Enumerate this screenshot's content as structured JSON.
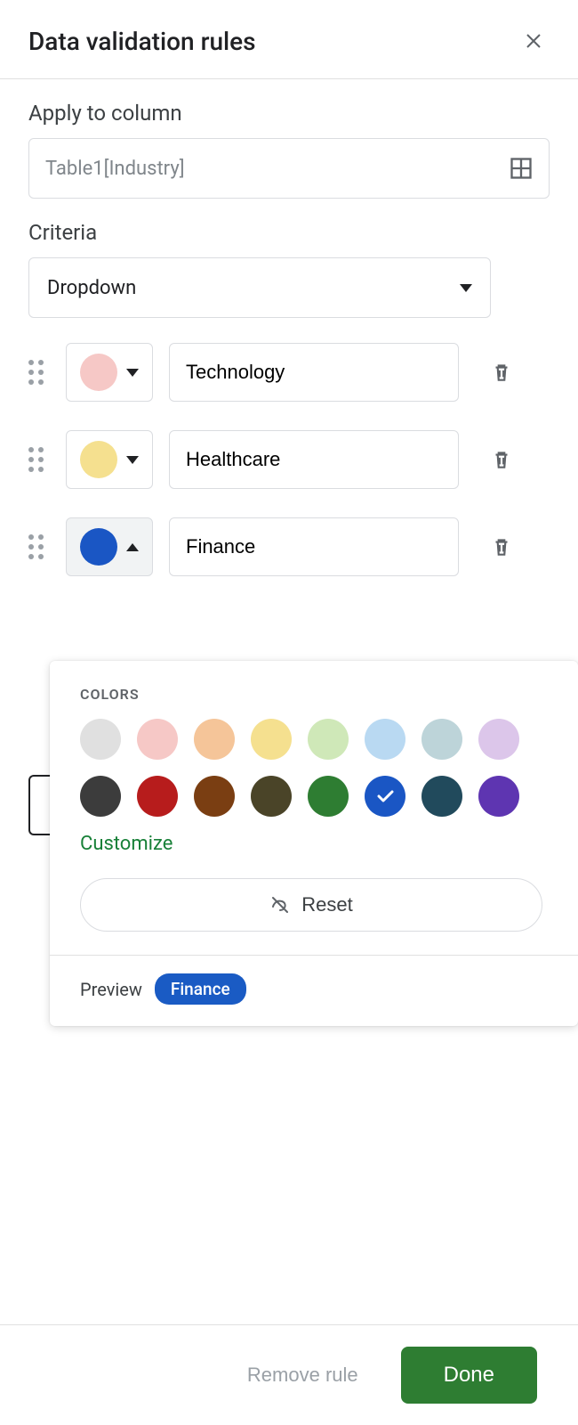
{
  "header": {
    "title": "Data validation rules"
  },
  "apply": {
    "label": "Apply to column",
    "value": "Table1[Industry]"
  },
  "criteria": {
    "label": "Criteria",
    "selected": "Dropdown"
  },
  "options": [
    {
      "label": "Technology",
      "color": "#f6c8c6",
      "open": false,
      "arrow": "down"
    },
    {
      "label": "Healthcare",
      "color": "#f5e08f",
      "open": false,
      "arrow": "down"
    },
    {
      "label": "Finance",
      "color": "#1a56c4",
      "open": true,
      "arrow": "up"
    }
  ],
  "color_popup": {
    "title": "COLORS",
    "light_row": [
      "#e0e0e0",
      "#f6c8c6",
      "#f5c599",
      "#f5e08f",
      "#cfe8b8",
      "#b9d9f2",
      "#bdd4d9",
      "#dcc6ea"
    ],
    "dark_row": [
      "#3c3c3c",
      "#b71c1c",
      "#7a3e12",
      "#4a4428",
      "#2e7d32",
      "#1a56c4",
      "#214a5c",
      "#5e35b1"
    ],
    "selected_color": "#1a56c4",
    "customize_label": "Customize",
    "reset_label": "Reset",
    "preview_label": "Preview",
    "preview_value": "Finance"
  },
  "footer": {
    "remove_label": "Remove rule",
    "done_label": "Done"
  }
}
